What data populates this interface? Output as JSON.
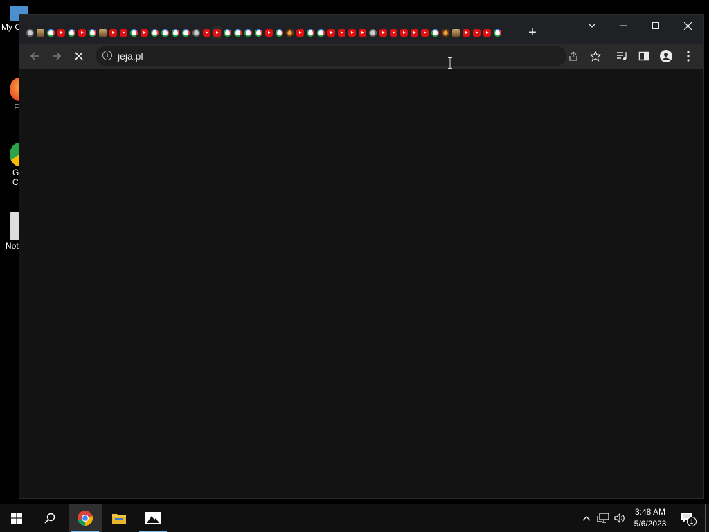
{
  "desktop": {
    "icons": [
      {
        "label": "My C",
        "color": "#5aa0e0"
      },
      {
        "label": "F",
        "color": "#e04020"
      },
      {
        "label": "G\nCl",
        "color": "#2aa34a"
      },
      {
        "label": "Not",
        "color": "#dddddd"
      }
    ]
  },
  "browser": {
    "tabs": [
      "github",
      "anime",
      "g",
      "yt",
      "g",
      "yt",
      "g",
      "anime",
      "yt",
      "yt",
      "g",
      "yt",
      "g",
      "g",
      "g",
      "g",
      "gp",
      "yt",
      "yt",
      "g",
      "g",
      "g",
      "g",
      "yt",
      "g",
      "burger",
      "yt",
      "g",
      "g",
      "yt",
      "yt",
      "yt",
      "yt",
      "gp",
      "yt",
      "yt",
      "yt",
      "yt",
      "yt",
      "g",
      "burger",
      "anime",
      "yt",
      "yt",
      "yt",
      "g"
    ],
    "active_tab_index": 18,
    "new_tab_label": "+",
    "window_controls": {
      "tab_search": "⌄",
      "minimize": "—",
      "maximize": "☐",
      "close": "✕"
    },
    "toolbar": {
      "back_icon": "←",
      "forward_icon": "→",
      "stop_icon": "✕",
      "url": "jeja.pl",
      "site_info_icon": "i"
    }
  },
  "taskbar": {
    "time": "3:48 AM",
    "date": "5/6/2023",
    "notification_count": "1"
  },
  "colors": {
    "chrome_frame": "#202124",
    "toolbar": "#2a2a2a",
    "page_bg": "#131313",
    "taskbar": "#101010",
    "accent": "#76b9ed"
  }
}
